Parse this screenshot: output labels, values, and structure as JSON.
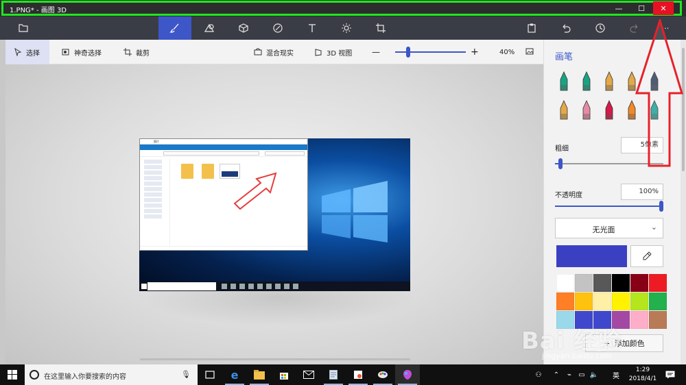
{
  "window": {
    "title": "1.PNG* - 画图 3D",
    "min_glyph": "—",
    "max_glyph": "☐",
    "close_glyph": "✕"
  },
  "ribbon": {
    "tools": [
      {
        "name": "menu",
        "icon": "folder-icon"
      },
      {
        "name": "brushes",
        "icon": "brush-icon",
        "active": true
      },
      {
        "name": "2d-shapes",
        "icon": "shapes-2d-icon"
      },
      {
        "name": "3d-shapes",
        "icon": "cube-icon"
      },
      {
        "name": "stickers",
        "icon": "sticker-icon"
      },
      {
        "name": "text",
        "icon": "text-icon"
      },
      {
        "name": "effects",
        "icon": "sun-icon"
      },
      {
        "name": "canvas",
        "icon": "crop-canvas-icon"
      },
      {
        "name": "paste",
        "icon": "paste-icon"
      },
      {
        "name": "undo",
        "icon": "undo-icon"
      },
      {
        "name": "history",
        "icon": "history-icon"
      },
      {
        "name": "redo",
        "icon": "redo-icon"
      },
      {
        "name": "more",
        "icon": "more-icon"
      }
    ],
    "more_label": "···"
  },
  "subbar": {
    "select": "选择",
    "magic_select": "神奇选择",
    "crop": "裁剪",
    "mixed_reality": "混合现实",
    "view_3d": "3D 视图",
    "zoom_minus": "—",
    "zoom_plus": "+",
    "zoom_percent": "40%",
    "zoom_fraction": 0.16
  },
  "screenshot_content": {
    "explorer_title": "图片"
  },
  "panel": {
    "title": "画笔",
    "brushes": [
      {
        "name": "marker",
        "color": "#1aa383"
      },
      {
        "name": "calligraphy-pen",
        "color": "#1aa383"
      },
      {
        "name": "oil-brush",
        "color": "#e2a84a"
      },
      {
        "name": "watercolor",
        "color": "#e2a84a"
      },
      {
        "name": "pixel-pen",
        "color": "#3d4a66"
      },
      {
        "name": "pencil",
        "color": "#e2a84a"
      },
      {
        "name": "eraser",
        "color": "#e68aa5"
      },
      {
        "name": "crayon",
        "color": "#d6184a"
      },
      {
        "name": "spray-can",
        "color": "#f0892a"
      },
      {
        "name": "fill",
        "color": "#2aa59c"
      }
    ],
    "thickness_label": "粗细",
    "thickness_value": "5像素",
    "thickness_fraction": 0.05,
    "opacity_label": "不透明度",
    "opacity_value": "100%",
    "opacity_fraction": 1.0,
    "finish_label": "无光面",
    "current_color": "#3b40c2",
    "palette": [
      "#ffffff",
      "#c3c3c3",
      "#585858",
      "#000000",
      "#880015",
      "#ed1c24",
      "#ff7f27",
      "#ffc20e",
      "#fff0a5",
      "#fff200",
      "#b5e61d",
      "#22b14c",
      "#99d9ea",
      "#3f48cc",
      "#3f48cc",
      "#a349a4",
      "#ffaec9",
      "#b97a57"
    ],
    "add_color_plus": "+",
    "add_color_label": "添加颜色"
  },
  "watermark": {
    "text": "Bai 经验",
    "sub": "jingyan.baidu.com"
  },
  "taskbar": {
    "search_placeholder": "在这里输入你要搜索的内容",
    "time": "1:29",
    "date": "2018/4/1",
    "ime": "英",
    "apps": [
      "task-view-icon",
      "edge-icon",
      "file-explorer-icon",
      "store-icon",
      "mail-icon",
      "notepad-icon",
      "snipping-tool-icon",
      "paint-icon",
      "paint-3d-icon"
    ]
  }
}
